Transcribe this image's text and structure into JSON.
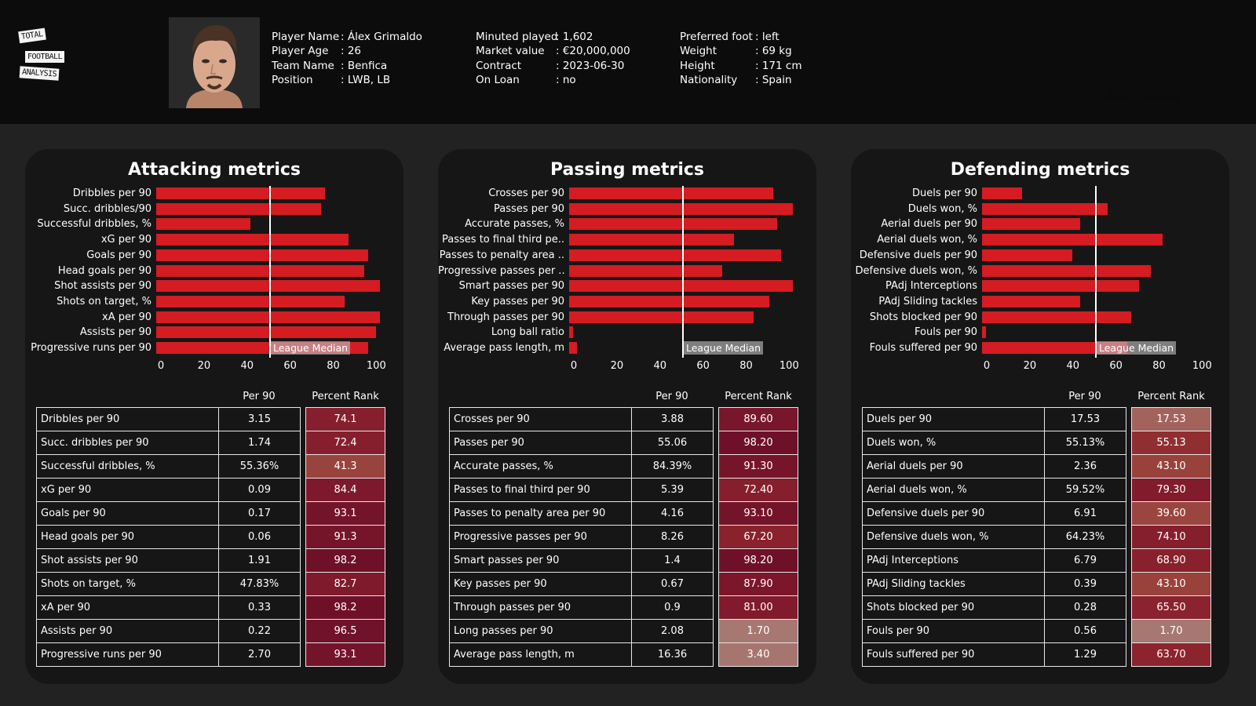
{
  "header": {
    "logo": [
      "TOTAL",
      "FOOTBALL",
      "ANALYSIS"
    ],
    "photo_icon": "player-photo",
    "ghost_name": "Álex Grimaldo",
    "col1": [
      {
        "key": "Player Name",
        "value": ": Álex Grimaldo"
      },
      {
        "key": "Player Age",
        "value": ": 26"
      },
      {
        "key": "Team Name",
        "value": ": Benfica"
      },
      {
        "key": "Position",
        "value": ": LWB, LB"
      }
    ],
    "col2": [
      {
        "key": "Minuted played",
        "value": ": 1,602"
      },
      {
        "key": "Market value",
        "value": ": €20,000,000"
      },
      {
        "key": "Contract",
        "value": ": 2023-06-30"
      },
      {
        "key": "On Loan",
        "value": ": no"
      }
    ],
    "col3": [
      {
        "key": "Preferred foot",
        "value": ": left"
      },
      {
        "key": "Weight",
        "value": ": 69 kg"
      },
      {
        "key": "Height",
        "value": ": 171 cm"
      },
      {
        "key": "Nationality",
        "value": ": Spain"
      }
    ]
  },
  "colors": {
    "bar": "#d41c22",
    "rank_low": "#a87a74",
    "rank_mid": "#973a35",
    "rank_high": "#6e1228"
  },
  "table_headers": {
    "per90": "Per 90",
    "rank": "Percent Rank"
  },
  "chart_data": [
    {
      "type": "bar",
      "title": "Attacking metrics",
      "orientation": "horizontal",
      "categories": [
        "Dribbles per 90",
        "Succ. dribbles/90",
        "Successful dribbles, %",
        "xG per 90",
        "Goals per 90",
        "Head goals per 90",
        "Shot assists per 90",
        "Shots on target, %",
        "xA per 90",
        "Assists per 90",
        "Progressive runs per 90"
      ],
      "values": [
        74.1,
        72.4,
        41.3,
        84.4,
        93.1,
        91.3,
        98.2,
        82.7,
        98.2,
        96.5,
        93.1
      ],
      "xlim": [
        0,
        100
      ],
      "xticks": [
        "0",
        "20",
        "40",
        "60",
        "80",
        "100"
      ],
      "median": 50,
      "median_label": "League Median",
      "table": [
        {
          "metric": "Dribbles per 90",
          "per90": "3.15",
          "rank": "74.1"
        },
        {
          "metric": "Succ. dribbles per 90",
          "per90": "1.74",
          "rank": "72.4"
        },
        {
          "metric": "Successful dribbles, %",
          "per90": "55.36%",
          "rank": "41.3"
        },
        {
          "metric": "xG per 90",
          "per90": "0.09",
          "rank": "84.4"
        },
        {
          "metric": "Goals per 90",
          "per90": "0.17",
          "rank": "93.1"
        },
        {
          "metric": "Head goals per 90",
          "per90": "0.06",
          "rank": "91.3"
        },
        {
          "metric": "Shot assists per 90",
          "per90": "1.91",
          "rank": "98.2"
        },
        {
          "metric": "Shots on target, %",
          "per90": "47.83%",
          "rank": "82.7"
        },
        {
          "metric": "xA per 90",
          "per90": "0.33",
          "rank": "98.2"
        },
        {
          "metric": "Assists per 90",
          "per90": "0.22",
          "rank": "96.5"
        },
        {
          "metric": "Progressive runs per 90",
          "per90": "2.70",
          "rank": "93.1"
        }
      ]
    },
    {
      "type": "bar",
      "title": "Passing metrics",
      "orientation": "horizontal",
      "categories": [
        "Crosses per 90",
        "Passes per 90",
        "Accurate passes, %",
        "Passes to final third pe..",
        "Passes to penalty area ..",
        "Progressive passes per ..",
        "Smart passes per 90",
        "Key passes per 90",
        "Through passes per 90",
        "Long ball ratio",
        "Average pass length, m"
      ],
      "values": [
        89.6,
        98.2,
        91.3,
        72.4,
        93.1,
        67.2,
        98.2,
        87.9,
        81.0,
        1.7,
        3.4
      ],
      "xlim": [
        0,
        100
      ],
      "xticks": [
        "0",
        "20",
        "40",
        "60",
        "80",
        "100"
      ],
      "median": 50,
      "median_label": "League Median",
      "table": [
        {
          "metric": "Crosses per 90",
          "per90": "3.88",
          "rank": "89.60"
        },
        {
          "metric": "Passes per 90",
          "per90": "55.06",
          "rank": "98.20"
        },
        {
          "metric": "Accurate passes, %",
          "per90": "84.39%",
          "rank": "91.30"
        },
        {
          "metric": "Passes to final third per 90",
          "per90": "5.39",
          "rank": "72.40"
        },
        {
          "metric": "Passes to penalty area per 90",
          "per90": "4.16",
          "rank": "93.10"
        },
        {
          "metric": "Progressive passes per 90",
          "per90": "8.26",
          "rank": "67.20"
        },
        {
          "metric": "Smart passes per 90",
          "per90": "1.4",
          "rank": "98.20"
        },
        {
          "metric": "Key passes per 90",
          "per90": "0.67",
          "rank": "87.90"
        },
        {
          "metric": "Through passes per 90",
          "per90": "0.9",
          "rank": "81.00"
        },
        {
          "metric": "Long passes per 90",
          "per90": "2.08",
          "rank": "1.70"
        },
        {
          "metric": "Average pass length, m",
          "per90": "16.36",
          "rank": "3.40"
        }
      ]
    },
    {
      "type": "bar",
      "title": "Defending metrics",
      "orientation": "horizontal",
      "categories": [
        "Duels per 90",
        "Duels won, %",
        "Aerial duels per 90",
        "Aerial duels won, %",
        "Defensive duels per 90",
        "Defensive duels won, %",
        "PAdj Interceptions",
        "PAdj Sliding tackles",
        "Shots blocked per 90",
        "Fouls per 90",
        "Fouls suffered per 90"
      ],
      "values": [
        17.53,
        55.13,
        43.1,
        79.3,
        39.6,
        74.1,
        68.9,
        43.1,
        65.5,
        1.7,
        63.7
      ],
      "xlim": [
        0,
        100
      ],
      "xticks": [
        "0",
        "20",
        "40",
        "60",
        "80",
        "100"
      ],
      "median": 50,
      "median_label": "League Median",
      "table": [
        {
          "metric": "Duels per 90",
          "per90": "17.53",
          "rank": "17.53"
        },
        {
          "metric": "Duels won, %",
          "per90": "55.13%",
          "rank": "55.13"
        },
        {
          "metric": "Aerial duels per 90",
          "per90": "2.36",
          "rank": "43.10"
        },
        {
          "metric": "Aerial duels won, %",
          "per90": "59.52%",
          "rank": "79.30"
        },
        {
          "metric": "Defensive duels per 90",
          "per90": "6.91",
          "rank": "39.60"
        },
        {
          "metric": "Defensive duels won, %",
          "per90": "64.23%",
          "rank": "74.10"
        },
        {
          "metric": "PAdj Interceptions",
          "per90": "6.79",
          "rank": "68.90"
        },
        {
          "metric": "PAdj Sliding tackles",
          "per90": "0.39",
          "rank": "43.10"
        },
        {
          "metric": "Shots blocked per 90",
          "per90": "0.28",
          "rank": "65.50"
        },
        {
          "metric": "Fouls per 90",
          "per90": "0.56",
          "rank": "1.70"
        },
        {
          "metric": "Fouls suffered per 90",
          "per90": "1.29",
          "rank": "63.70"
        }
      ]
    }
  ]
}
